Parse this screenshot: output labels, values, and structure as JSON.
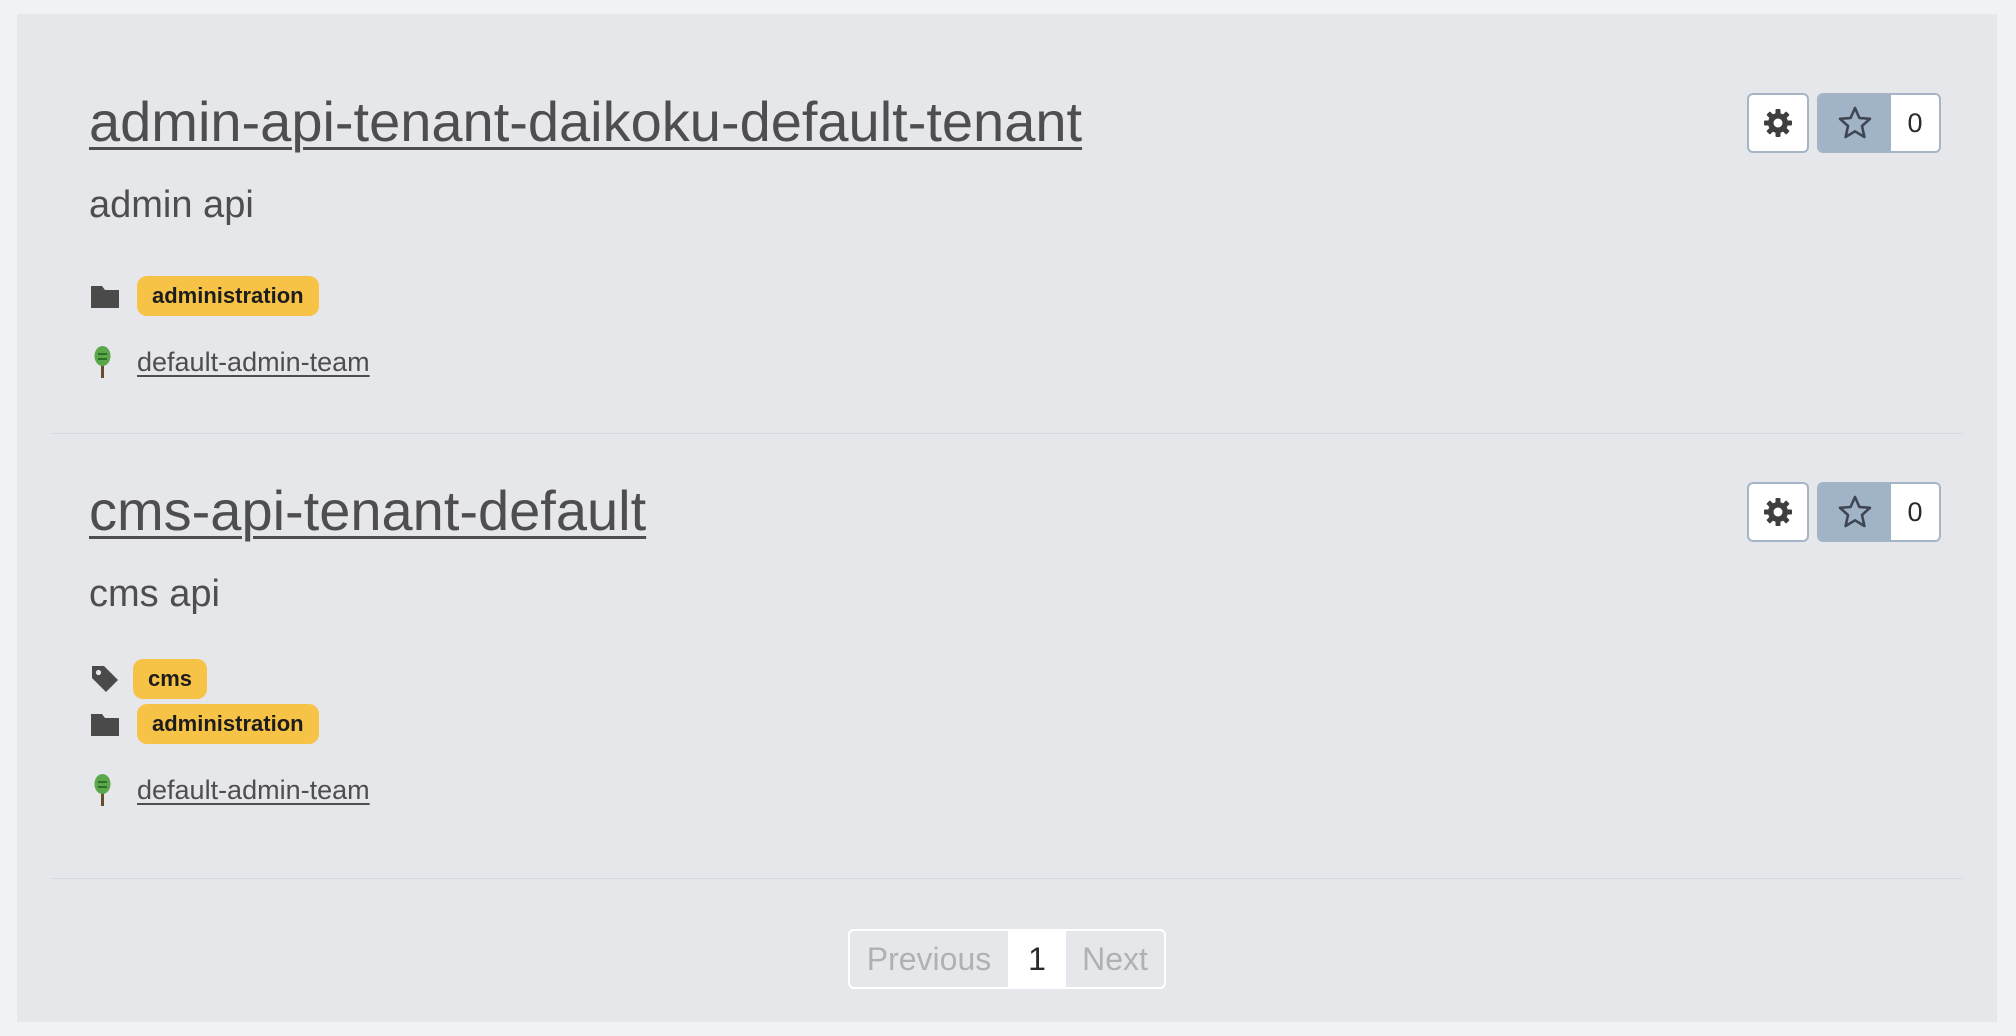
{
  "apis": [
    {
      "title": "admin-api-tenant-daikoku-default-tenant",
      "description": "admin api",
      "tags": [],
      "categories": [
        "administration"
      ],
      "team": "default-admin-team",
      "star_count": "0"
    },
    {
      "title": "cms-api-tenant-default",
      "description": "cms api",
      "tags": [
        "cms"
      ],
      "categories": [
        "administration"
      ],
      "team": "default-admin-team",
      "star_count": "0"
    }
  ],
  "pagination": {
    "previous_label": "Previous",
    "current_page": "1",
    "next_label": "Next"
  },
  "colors": {
    "badge": "#f7c347",
    "star_button": "#a1b3c7",
    "panel_bg": "#e6e7eb"
  },
  "icons": {
    "settings": "gear-icon",
    "star": "star-icon",
    "tag": "tag-icon",
    "category": "folder-icon",
    "team": "team-avatar-icon"
  }
}
